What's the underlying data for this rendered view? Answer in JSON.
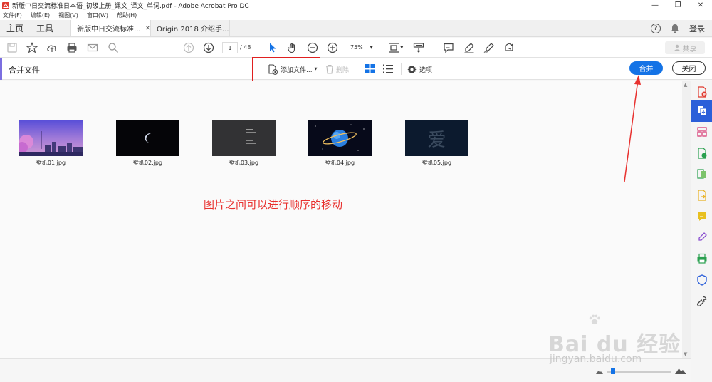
{
  "window": {
    "title": "新版中日交流标准日本语_初级上册_课文_译文_单词.pdf - Adobe Acrobat Pro DC"
  },
  "menu": [
    "文件(F)",
    "编辑(E)",
    "视图(V)",
    "窗口(W)",
    "帮助(H)"
  ],
  "tabs": {
    "home": "主页",
    "tools": "工具",
    "doc1": "新版中日交流标准...",
    "doc2": "Origin 2018 介绍手...",
    "login": "登录"
  },
  "toolbar": {
    "page_current": "1",
    "page_total": "/ 48",
    "zoom": "75%",
    "share": "共享"
  },
  "combine": {
    "title": "合并文件",
    "add_files": "添加文件...",
    "delete": "删除",
    "options": "选项",
    "merge": "合并",
    "close": "关闭"
  },
  "files": [
    {
      "name": "壁纸01.jpg"
    },
    {
      "name": "壁纸02.jpg"
    },
    {
      "name": "壁纸03.jpg"
    },
    {
      "name": "壁纸04.jpg"
    },
    {
      "name": "壁纸05.jpg",
      "glyph": "爱"
    }
  ],
  "annotation": "图片之间可以进行顺序的移动",
  "watermark": {
    "brand": "Bai du 经验",
    "url": "jingyan.baidu.com"
  },
  "colors": {
    "accent": "#1473e6",
    "annotation": "#e8312f",
    "panel_active": "#2b5fd9"
  }
}
